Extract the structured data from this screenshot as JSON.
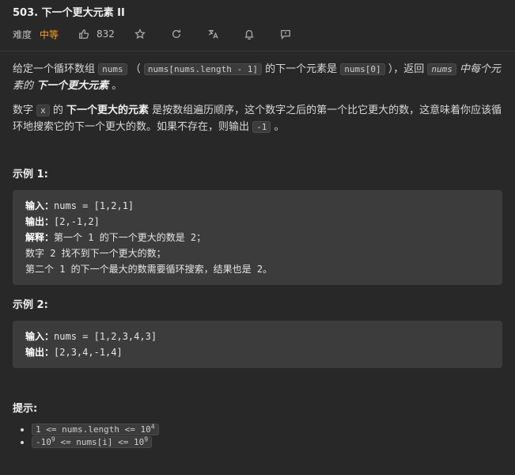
{
  "title": "503. 下一个更大元素 II",
  "meta": {
    "difficulty_label": "难度",
    "difficulty": "中等",
    "likes": "832"
  },
  "icons": {
    "like": "thumbs-up-icon",
    "star": "star-icon",
    "share": "refresh-icon",
    "translate": "translate-icon",
    "bell": "bell-icon",
    "feedback": "feedback-icon"
  },
  "description": {
    "p1": {
      "t1": "给定一个循环数组 ",
      "c1": "nums",
      "t2": " （ ",
      "c2": "nums[nums.length - 1]",
      "t3": " 的下一个元素是 ",
      "c3": "nums[0]",
      "t4": " ），返回 ",
      "c4": "nums",
      "e1": " 中每个元素的 ",
      "b1": "下一个更大元素",
      "t5": " 。"
    },
    "p2": {
      "t1": "数字 ",
      "c1": "x",
      "t2": " 的 ",
      "b1": "下一个更大的元素",
      "t3": " 是按数组遍历顺序，这个数字之后的第一个比它更大的数，这意味着你应该循环地搜索它的下一个更大的数。如果不存在，则输出 ",
      "c2": "-1",
      "t4": " 。"
    }
  },
  "example1": {
    "title": "示例 1:",
    "input_label": "输入：",
    "input": "nums = [1,2,1]",
    "output_label": "输出：",
    "output": "[2,-1,2]",
    "explain_label": "解释：",
    "explain1": "第一个 1 的下一个更大的数是 2；",
    "explain2": "数字 2 找不到下一个更大的数；",
    "explain3": "第二个 1 的下一个最大的数需要循环搜索，结果也是 2。"
  },
  "example2": {
    "title": "示例 2:",
    "input_label": "输入：",
    "input": "nums = [1,2,3,4,3]",
    "output_label": "输出：",
    "output": "[2,3,4,-1,4]"
  },
  "constraints": {
    "title": "提示:",
    "c1_base": "1 <= nums.length <= 10",
    "c1_exp": "4",
    "c2_pre": "-10",
    "c2_exp1": "9",
    "c2_mid": " <= nums[i] <= 10",
    "c2_exp2": "9"
  }
}
